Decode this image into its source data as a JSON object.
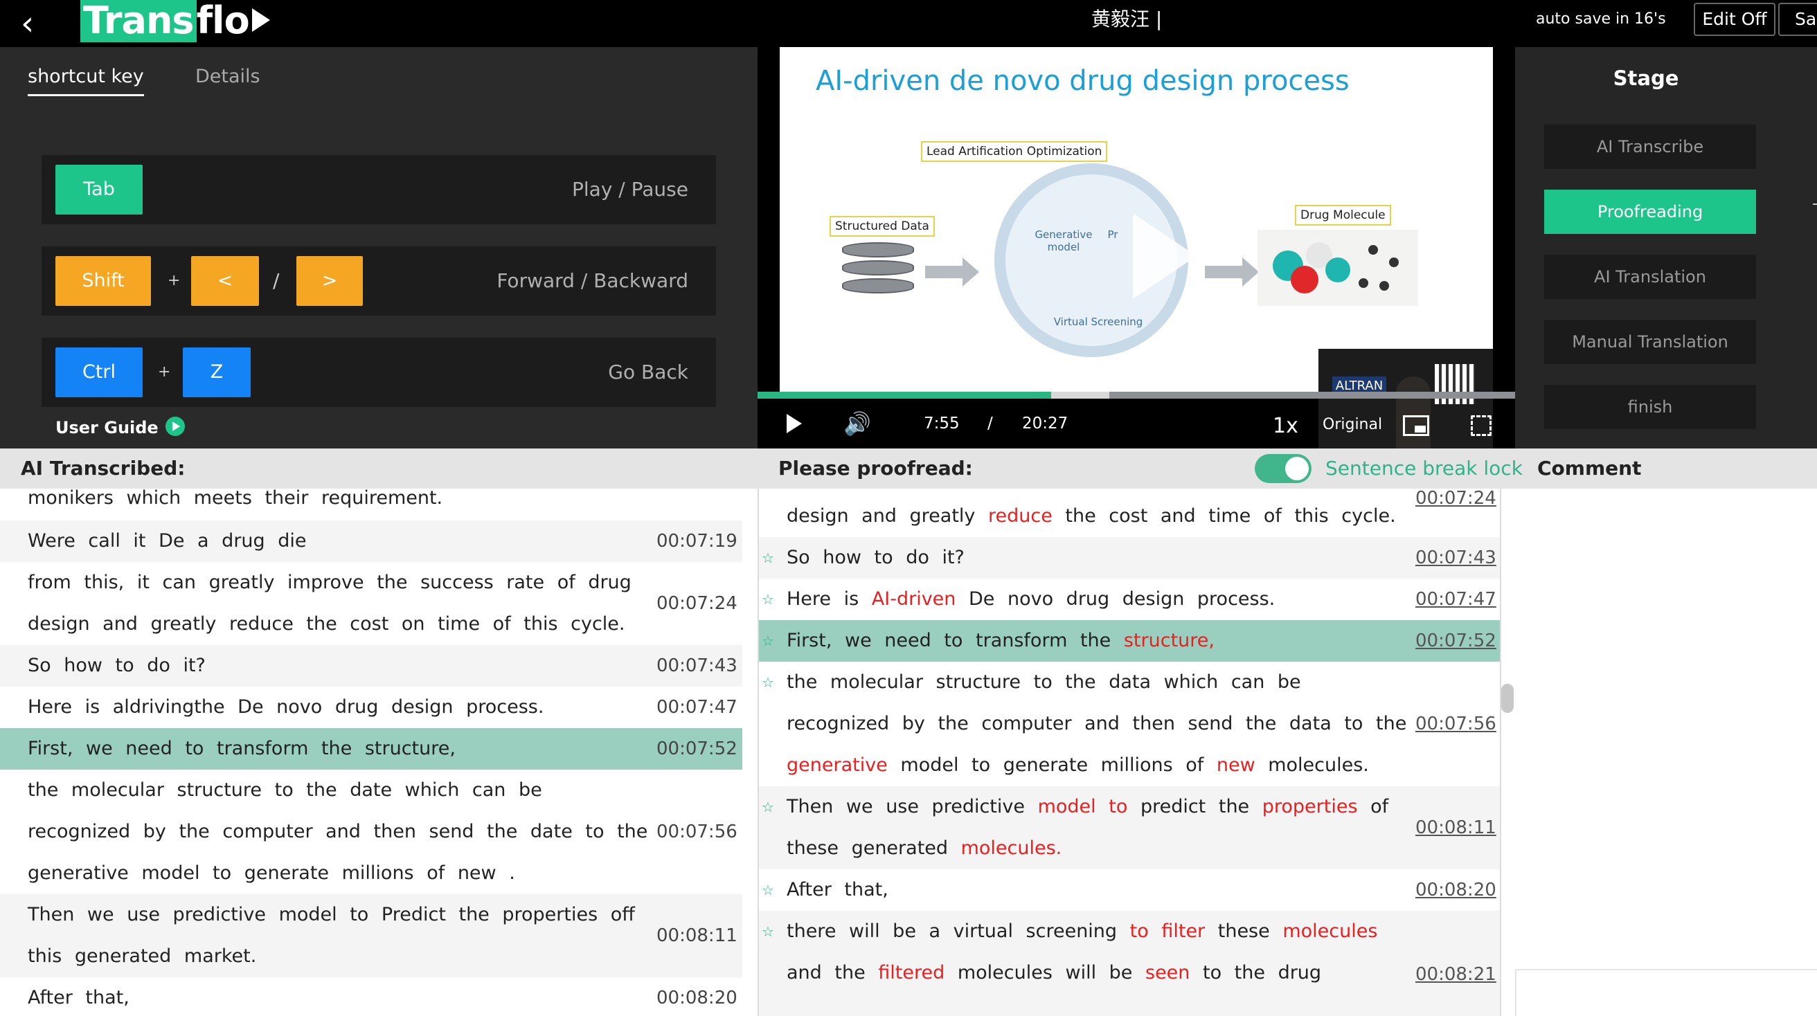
{
  "topbar": {
    "back_icon": "chevron-left-icon",
    "logo_prefix": "Trans",
    "logo_suffix": "flo",
    "title": "黄毅汪 |",
    "autosave": "auto save in 16's",
    "edit_off": "Edit Off",
    "save": "Save"
  },
  "shortcut": {
    "tab_active": "shortcut key",
    "tab_inactive": "Details",
    "rows": [
      {
        "keys": [
          "Tab"
        ],
        "label": "Play / Pause"
      },
      {
        "keys": [
          "Shift",
          "<",
          ">"
        ],
        "label": "Forward / Backward"
      },
      {
        "keys": [
          "Ctrl",
          "Z"
        ],
        "label": "Go Back"
      }
    ],
    "plus": "+",
    "slash": "/",
    "user_guide": "User Guide"
  },
  "video": {
    "slide_title": "AI-driven de novo drug design process",
    "slide_labels": {
      "structured": "Structured Data",
      "lead": "Lead Artification Optimization",
      "drug": "Drug Molecule",
      "generative": "Generative model",
      "virtual": "Virtual Screening",
      "pr": "Pr"
    },
    "pip_logo": "ALTRAN",
    "progress_fraction": 0.388,
    "current_time": "7:55",
    "separator": "/",
    "duration": "20:27",
    "speed": "1x",
    "original": "Original"
  },
  "stage": {
    "title": "Stage",
    "items": [
      {
        "label": "AI Transcribe",
        "active": false
      },
      {
        "label": "Proofreading",
        "active": true
      },
      {
        "label": "AI Translation",
        "active": false
      },
      {
        "label": "Manual Translation",
        "active": false
      },
      {
        "label": "finish",
        "active": false
      }
    ]
  },
  "headers": {
    "left": "AI Transcribed:",
    "mid": "Please proofread:",
    "lock": "Sentence break lock",
    "right": "Comment"
  },
  "transcribed": [
    {
      "lines": [
        "monikers which meets their requirement."
      ],
      "time": ""
    },
    {
      "lines": [
        "Were call it De a drug die"
      ],
      "time": "00:07:19"
    },
    {
      "lines": [
        "from this, it can greatly improve the success rate of drug",
        "design and greatly reduce the cost on time of this cycle."
      ],
      "time": "00:07:24"
    },
    {
      "lines": [
        "So how to do it?"
      ],
      "time": "00:07:43"
    },
    {
      "lines": [
        "Here is aldrivingthe De novo drug design process."
      ],
      "time": "00:07:47"
    },
    {
      "lines": [
        "First, we need to transform the structure,"
      ],
      "time": "00:07:52"
    },
    {
      "lines": [
        "the molecular structure to the date which can be",
        "recognized by the computer and then send the date to the",
        "generative model to generate millions of new ."
      ],
      "time": "00:07:56"
    },
    {
      "lines": [
        "Then we use predictive model to Predict the properties off",
        "this generated market."
      ],
      "time": "00:08:11"
    },
    {
      "lines": [
        "After that,"
      ],
      "time": "00:08:20"
    }
  ],
  "proofread": {
    "r0": {
      "a": "design and greatly ",
      "b": "reduce",
      "c": " the cost and time of this cycle.",
      "time": "00:07:24"
    },
    "r1": {
      "a": "So how to do it?",
      "time": "00:07:43"
    },
    "r2": {
      "a": "Here is ",
      "b": "AI-driven",
      "c": " De novo drug design process.",
      "time": "00:07:47"
    },
    "r3": {
      "a": "First, we need to transform the ",
      "b": "structure,",
      "time": "00:07:52"
    },
    "r4": {
      "l1": "the molecular structure to the data which can be",
      "l2": "recognized by the computer and then send the data to the",
      "l3a": "generative",
      "l3b": " model to generate millions of ",
      "l3c": "new",
      "l3d": " molecules.",
      "time": "00:07:56"
    },
    "r5": {
      "l1a": "Then we use predictive ",
      "l1b": "model",
      "l1c": " ",
      "l1d": "to",
      "l1e": " predict the ",
      "l1f": "properties",
      "l1g": " of",
      "l2a": "these generated ",
      "l2b": "molecules.",
      "time": "00:08:11"
    },
    "r6": {
      "a": "After that,",
      "time": "00:08:20"
    },
    "r7": {
      "l1a": "there will be a virtual screening ",
      "l1b": "to",
      "l1c": " ",
      "l1d": "filter",
      "l1e": " these ",
      "l1f": "molecules",
      "l2a": "and the ",
      "l2b": "filtered",
      "l2c": " molecules will be ",
      "l2d": "seen",
      "l2e": " to the drug",
      "time": "00:08:21"
    }
  },
  "icons": {
    "star": "☆",
    "volume": "🔊"
  },
  "colors": {
    "accent": "#1ec58a",
    "orange": "#f5a623",
    "blue": "#1483f5",
    "highlight_row": "#9acfbf",
    "correction_red": "#e8201f"
  }
}
